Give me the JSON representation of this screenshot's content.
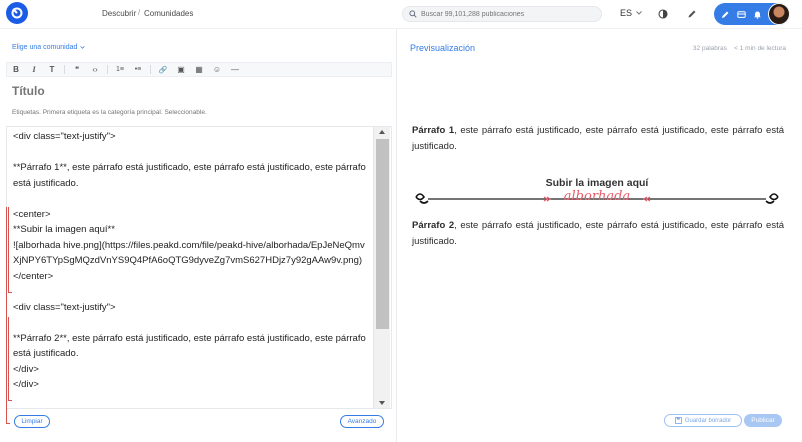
{
  "header": {
    "nav": [
      {
        "label": "Descubrir"
      },
      {
        "label": "Comunidades"
      }
    ],
    "nav_separator": "/",
    "search": {
      "placeholder": "Buscar 99,101,288 publicaciones"
    },
    "language": "ES",
    "icons": [
      "logo-icon",
      "search-icon",
      "chevron-down-icon",
      "theme-toggle-icon",
      "pencil-icon",
      "wallet-icon",
      "bell-icon"
    ],
    "accent_color": "#357ce6"
  },
  "editor": {
    "community_selector": "Elige una comunidad",
    "title_placeholder": "Título",
    "tags_placeholder": "Etiquetas. Primera etiqueta es la categoría principal. Seleccionable.",
    "toolbar_icons": [
      "bold-icon",
      "italic-icon",
      "heading-icon",
      "quote-icon",
      "code-icon",
      "ordered-list-icon",
      "bullet-list-icon",
      "link-icon",
      "image-icon",
      "table-icon",
      "emoji-icon",
      "horizontal-rule-icon"
    ],
    "toolbar_labels": [
      "B",
      "I",
      "T",
      "❝",
      "‹›",
      "1≡",
      "•≡",
      "🔗",
      "▣",
      "▦",
      "☺",
      "—"
    ],
    "body": "<div class=\"text-justify\">\n\n**Párrafo 1**, este párrafo está justificado, este párrafo está justificado, este párrafo está justificado.\n\n<center>\n**Subir la imagen aquí**\n![alborhada hive.png](https://files.peakd.com/file/peakd-hive/alborhada/EpJeNeQmvXjNPY6TYpSgMQzdVnYS9Q4PfA6oQTG9dyveZg7vmS627HDjz7y92gAAw9v.png)\n</center>\n\n<div class=\"text-justify\">\n\n**Párrafo 2**, este párrafo está justificado, este párrafo está justificado, este párrafo está justificado.\n</div>\n</div>",
    "clear_button": "Limpiar",
    "advanced_button": "Avanzado"
  },
  "preview": {
    "heading": "Previsualización",
    "word_count": "32 palabras",
    "read_time": "< 1 min de lectura",
    "paragraph1_bold": "Párrafo 1",
    "paragraph1_rest": ", este párrafo está justificado, este párrafo está justificado, este párrafo está justificado.",
    "banner_title": "Subir la imagen aquí",
    "banner_subtitle": "alborhada",
    "paragraph2_bold": "Párrafo 2",
    "paragraph2_rest": ", este párrafo está justificado, este párrafo está justificado, este párrafo está justificado.",
    "save_draft_button": "Guardar borrador",
    "publish_button": "Publicar"
  }
}
